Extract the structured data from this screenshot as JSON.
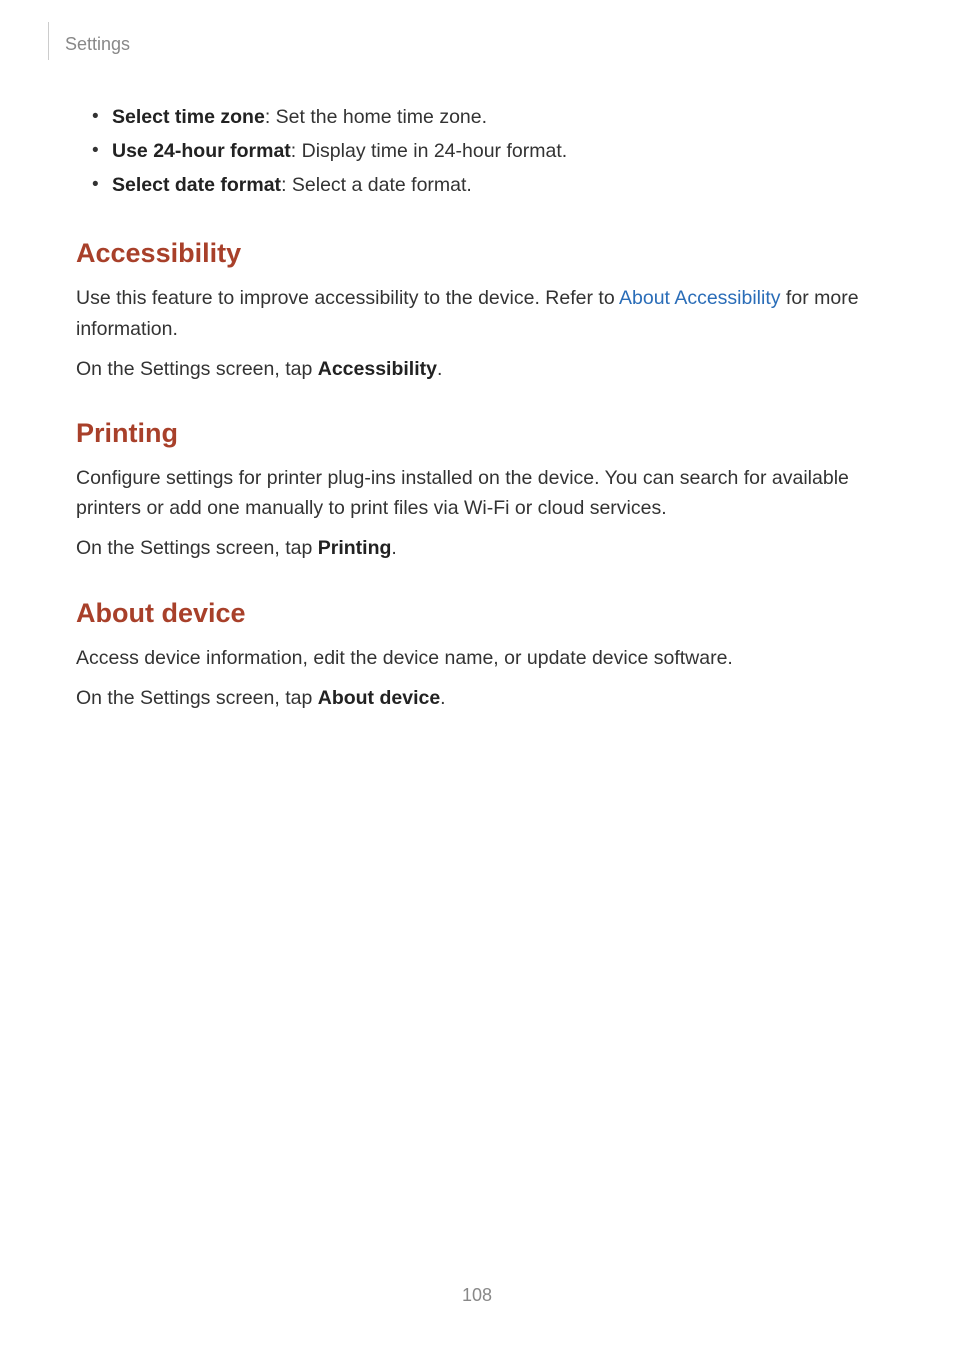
{
  "header": {
    "breadcrumb": "Settings"
  },
  "bullets": [
    {
      "term": "Select time zone",
      "desc": ": Set the home time zone."
    },
    {
      "term": "Use 24-hour format",
      "desc": ": Display time in 24-hour format."
    },
    {
      "term": "Select date format",
      "desc": ": Select a date format."
    }
  ],
  "sections": {
    "accessibility": {
      "heading": "Accessibility",
      "p1_pre": "Use this feature to improve accessibility to the device. Refer to ",
      "p1_link": "About Accessibility",
      "p1_post": " for more information.",
      "p2_pre": "On the Settings screen, tap ",
      "p2_bold": "Accessibility",
      "p2_post": "."
    },
    "printing": {
      "heading": "Printing",
      "p1": "Configure settings for printer plug-ins installed on the device. You can search for available printers or add one manually to print files via Wi-Fi or cloud services.",
      "p2_pre": "On the Settings screen, tap ",
      "p2_bold": "Printing",
      "p2_post": "."
    },
    "about": {
      "heading": "About device",
      "p1": "Access device information, edit the device name, or update device software.",
      "p2_pre": "On the Settings screen, tap ",
      "p2_bold": "About device",
      "p2_post": "."
    }
  },
  "page_number": "108"
}
